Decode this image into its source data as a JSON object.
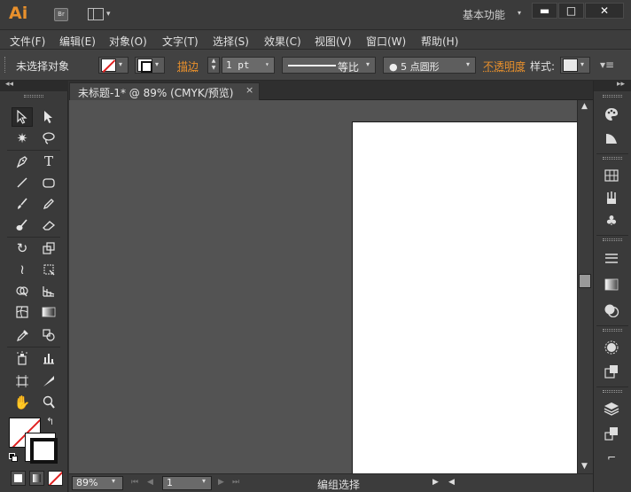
{
  "titlebar": {
    "logo": "Ai",
    "bridge_label": "Br",
    "workspace_label": "基本功能",
    "minimize": "▬",
    "maximize": "□",
    "close": "✕"
  },
  "menu": {
    "items": [
      "文件(F)",
      "编辑(E)",
      "对象(O)",
      "文字(T)",
      "选择(S)",
      "效果(C)",
      "视图(V)",
      "窗口(W)",
      "帮助(H)"
    ]
  },
  "control_bar": {
    "selection_status": "未选择对象",
    "stroke_label": "描边",
    "stroke_weight": "1 pt",
    "variable_width_profile": "等比",
    "brush_definition": "● 5 点圆形",
    "opacity_label": "不透明度",
    "style_label": "样式:"
  },
  "document": {
    "tab_title": "未标题-1* @ 89% (CMYK/预览)",
    "close_symbol": "×"
  },
  "status_bar": {
    "zoom": "89%",
    "artboard_number": "1",
    "status_text": "编组选择"
  },
  "colors": {
    "accent": "#e8902c",
    "panel_bg": "#3a3a3a",
    "canvas_bg": "#535353",
    "artboard": "#ffffff",
    "none_slash": "#e02020"
  },
  "tools": [
    "selection-tool-icon",
    "direct-selection-tool-icon",
    "magic-wand-tool-icon",
    "lasso-tool-icon",
    "pen-tool-icon",
    "type-tool-icon",
    "line-segment-tool-icon",
    "rounded-rectangle-tool-icon",
    "paintbrush-tool-icon",
    "pencil-tool-icon",
    "blob-brush-tool-icon",
    "eraser-tool-icon",
    "rotate-tool-icon",
    "scale-tool-icon",
    "width-tool-icon",
    "free-transform-tool-icon",
    "shape-builder-tool-icon",
    "perspective-grid-tool-icon",
    "mesh-tool-icon",
    "gradient-tool-icon",
    "eyedropper-tool-icon",
    "blend-tool-icon",
    "symbol-sprayer-tool-icon",
    "column-graph-tool-icon",
    "artboard-tool-icon",
    "slice-tool-icon",
    "hand-tool-icon",
    "zoom-tool-icon"
  ],
  "dock_panels": [
    "color-panel-icon",
    "color-guide-panel-icon",
    "swatches-panel-icon",
    "brushes-panel-icon",
    "symbols-panel-icon",
    "stroke-panel-icon",
    "gradient-panel-icon",
    "transparency-panel-icon",
    "appearance-panel-icon",
    "graphic-styles-panel-icon",
    "layers-panel-icon",
    "artboards-panel-icon",
    "links-panel-icon"
  ]
}
